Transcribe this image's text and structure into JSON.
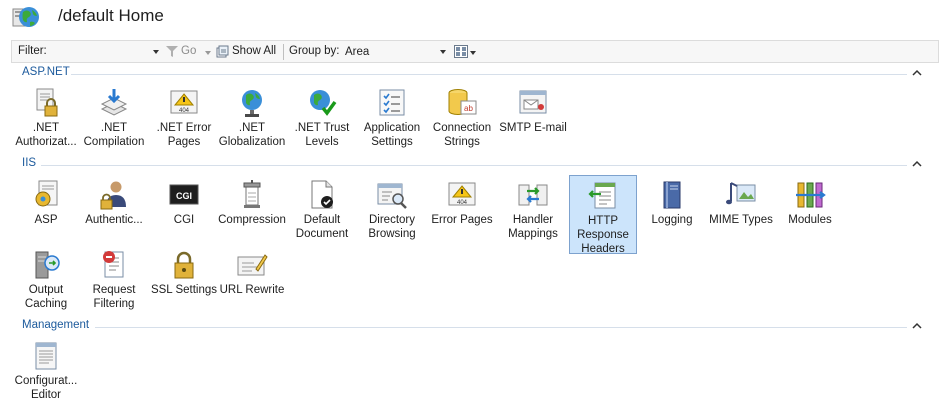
{
  "header": {
    "title": "/default Home",
    "globe_icon": "iis-site-globe-icon"
  },
  "toolbar": {
    "filter_label": "Filter:",
    "filter_value": "",
    "go_label": "Go",
    "show_all_label": "Show All",
    "group_by_label": "Group by:",
    "group_by_value": "Area"
  },
  "groups": {
    "aspnet": {
      "name": "ASP.NET",
      "items": [
        {
          "line1": ".NET",
          "line2": "Authorizat..."
        },
        {
          "line1": ".NET",
          "line2": "Compilation"
        },
        {
          "line1": ".NET Error",
          "line2": "Pages"
        },
        {
          "line1": ".NET",
          "line2": "Globalization"
        },
        {
          "line1": ".NET Trust",
          "line2": "Levels"
        },
        {
          "line1": "Application",
          "line2": "Settings"
        },
        {
          "line1": "Connection",
          "line2": "Strings"
        },
        {
          "line1": "SMTP E-mail",
          "line2": ""
        }
      ]
    },
    "iis": {
      "name": "IIS",
      "items": [
        {
          "line1": "ASP",
          "line2": ""
        },
        {
          "line1": "Authentic...",
          "line2": ""
        },
        {
          "line1": "CGI",
          "line2": ""
        },
        {
          "line1": "Compression",
          "line2": ""
        },
        {
          "line1": "Default",
          "line2": "Document"
        },
        {
          "line1": "Directory",
          "line2": "Browsing"
        },
        {
          "line1": "Error Pages",
          "line2": ""
        },
        {
          "line1": "Handler",
          "line2": "Mappings"
        },
        {
          "line1": "HTTP",
          "line2": "Response",
          "line3": "Headers"
        },
        {
          "line1": "Logging",
          "line2": ""
        },
        {
          "line1": "MIME Types",
          "line2": ""
        },
        {
          "line1": "Modules",
          "line2": ""
        },
        {
          "line1": "Output",
          "line2": "Caching"
        },
        {
          "line1": "Request",
          "line2": "Filtering"
        },
        {
          "line1": "SSL Settings",
          "line2": ""
        },
        {
          "line1": "URL Rewrite",
          "line2": ""
        }
      ]
    },
    "management": {
      "name": "Management",
      "items": [
        {
          "line1": "Configurat...",
          "line2": "Editor"
        }
      ]
    }
  },
  "colors": {
    "group_title": "#1c5a9c",
    "selected_bg": "#cce4fb",
    "selected_border": "#7da2ce"
  }
}
